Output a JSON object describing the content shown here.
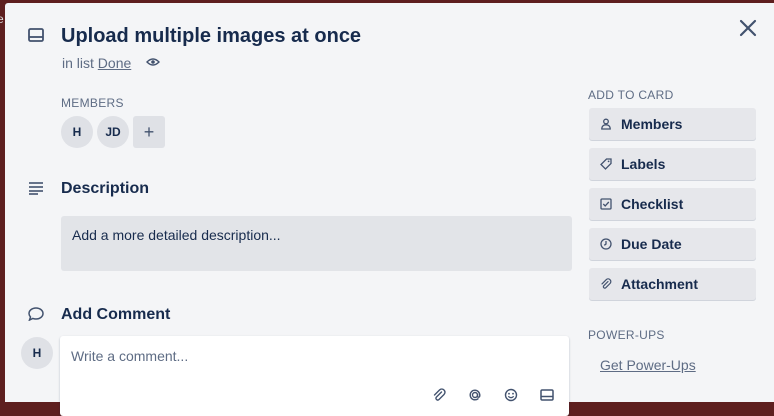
{
  "card": {
    "title": "Upload multiple images at once",
    "in_list_prefix": "in list",
    "list_name": "Done"
  },
  "left_edge_char": "e",
  "members": {
    "label": "MEMBERS",
    "avatars": [
      "H",
      "JD"
    ],
    "add_label": "+"
  },
  "description": {
    "title": "Description",
    "placeholder": "Add a more detailed description..."
  },
  "comment": {
    "title": "Add Comment",
    "avatar": "H",
    "placeholder": "Write a comment..."
  },
  "sidebar": {
    "add_to_card_label": "ADD TO CARD",
    "buttons": [
      {
        "label": "Members",
        "icon": "person-icon"
      },
      {
        "label": "Labels",
        "icon": "tag-icon"
      },
      {
        "label": "Checklist",
        "icon": "checkbox-icon"
      },
      {
        "label": "Due Date",
        "icon": "clock-icon"
      },
      {
        "label": "Attachment",
        "icon": "paperclip-icon"
      }
    ],
    "powerups_label": "POWER-UPS",
    "get_powerups": "Get Power-Ups"
  },
  "colors": {
    "backdrop": "#5e1f1f",
    "modal_bg": "#f4f5f7",
    "text": "#172b4d",
    "muted": "#5e6c84",
    "button_bg": "#e6e7eb"
  }
}
